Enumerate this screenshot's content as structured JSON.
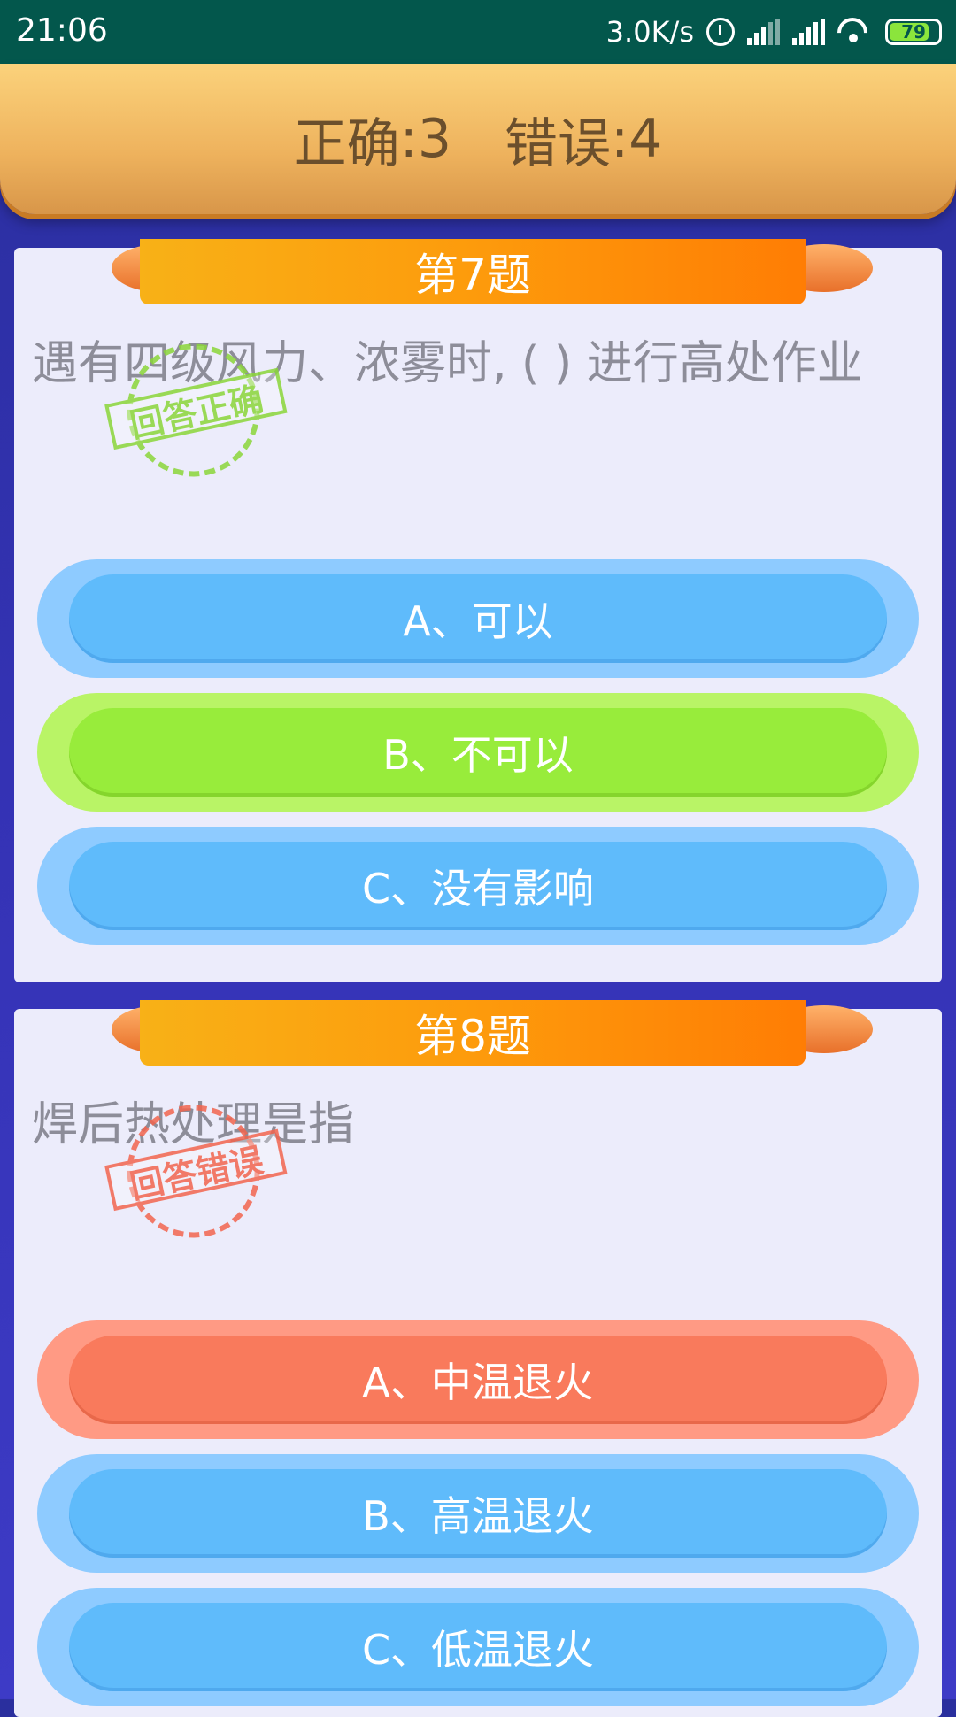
{
  "status_bar": {
    "time": "21:06",
    "net_speed": "3.0K/s",
    "battery": "79",
    "icons": [
      "alarm-icon",
      "signal-icon",
      "signal-icon",
      "wifi-icon",
      "battery-icon"
    ]
  },
  "score": {
    "correct_label": "正确",
    "correct_value": "3",
    "wrong_label": "错误",
    "wrong_value": "4"
  },
  "questions": [
    {
      "title": "第7题",
      "text": "遇有四级风力、浓雾时, ( ) 进行高处作业",
      "stamp": "回答正确",
      "options": [
        {
          "label": "A、可以",
          "state": "normal"
        },
        {
          "label": "B、不可以",
          "state": "correct"
        },
        {
          "label": "C、没有影响",
          "state": "normal"
        }
      ]
    },
    {
      "title": "第8题",
      "text": "焊后热处理是指",
      "stamp": "回答错误",
      "options": [
        {
          "label": "A、中温退火",
          "state": "wrong"
        },
        {
          "label": "B、高温退火",
          "state": "normal"
        },
        {
          "label": "C、低温退火",
          "state": "normal"
        }
      ]
    }
  ],
  "colors": {
    "status_bar": "#03574c",
    "option_blue": "#5fbbfb",
    "option_green": "#98ec3b",
    "option_red": "#f97a5c",
    "ribbon": "#fd9b0c"
  }
}
